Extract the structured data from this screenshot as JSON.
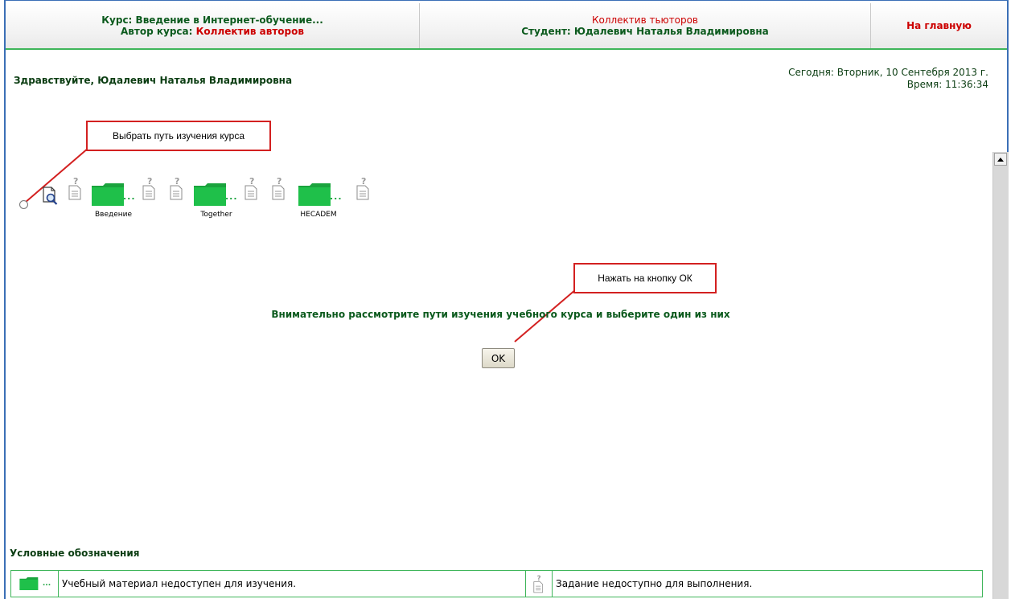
{
  "header": {
    "course_label": "Курс:",
    "course_name": "Введение в Интернет-обучение...",
    "author_label": "Автор курса:",
    "author_name": "Коллектив авторов",
    "tutors": "Коллектив тьюторов",
    "student_label": "Студент:",
    "student_name": "Юдалевич Наталья Владимировна",
    "home_link": "На главную"
  },
  "greeting": "Здравствуйте, Юдалевич Наталья Владимировна",
  "date": {
    "today_label": "Сегодня:",
    "today_value": "Вторник, 10 Сентебря 2013 г.",
    "time_label": "Время:",
    "time_value": "11:36:34"
  },
  "callouts": {
    "choose_path": "Выбрать путь изучения курса",
    "press_ok": "Нажать на кнопку ОК"
  },
  "path": {
    "modules": [
      {
        "label": "Введение"
      },
      {
        "label": "Together"
      },
      {
        "label": "HECADEM"
      }
    ],
    "dots": "..."
  },
  "instruction": "Внимательно рассмотрите пути изучения учебного курса и выберите один из них",
  "ok_button": "OK",
  "legend": {
    "title": "Условные обозначения",
    "material_unavailable": "Учебный материал недоступен для изучения.",
    "task_unavailable": "Задание недоступно для выполнения."
  },
  "colors": {
    "accent_green": "#0b5a1d",
    "folder_green": "#1aa33d",
    "alert_red": "#cc0000",
    "callout_red": "#d32020"
  },
  "icons": {
    "preview": "magnifier-page-icon",
    "task": "question-document-icon",
    "folder": "green-folder-icon"
  }
}
